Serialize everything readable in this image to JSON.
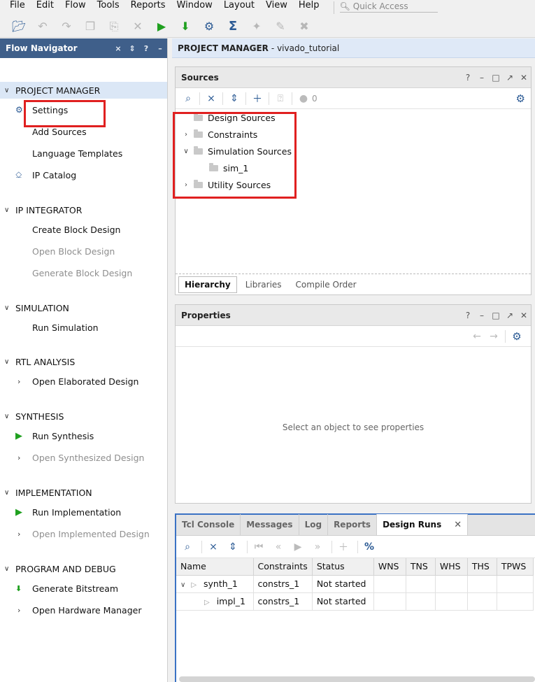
{
  "menubar": {
    "items": [
      "File",
      "Edit",
      "Flow",
      "Tools",
      "Reports",
      "Window",
      "Layout",
      "View",
      "Help"
    ],
    "quick_access_placeholder": "Quick Access"
  },
  "flow_navigator": {
    "title": "Flow Navigator",
    "sections": [
      {
        "label": "PROJECT MANAGER",
        "items": [
          "Settings",
          "Add Sources",
          "Language Templates",
          "IP Catalog"
        ]
      },
      {
        "label": "IP INTEGRATOR",
        "items": [
          "Create Block Design",
          "Open Block Design",
          "Generate Block Design"
        ]
      },
      {
        "label": "SIMULATION",
        "items": [
          "Run Simulation"
        ]
      },
      {
        "label": "RTL ANALYSIS",
        "items": [
          "Open Elaborated Design"
        ]
      },
      {
        "label": "SYNTHESIS",
        "items": [
          "Run Synthesis",
          "Open Synthesized Design"
        ]
      },
      {
        "label": "IMPLEMENTATION",
        "items": [
          "Run Implementation",
          "Open Implemented Design"
        ]
      },
      {
        "label": "PROGRAM AND DEBUG",
        "items": [
          "Generate Bitstream",
          "Open Hardware Manager"
        ]
      }
    ]
  },
  "project_manager": {
    "title_bold": "PROJECT MANAGER",
    "title_rest": "- vivado_tutorial"
  },
  "sources": {
    "title": "Sources",
    "count": "0",
    "tree": [
      "Design Sources",
      "Constraints",
      "Simulation Sources",
      "sim_1",
      "Utility Sources"
    ],
    "tabs": [
      "Hierarchy",
      "Libraries",
      "Compile Order"
    ]
  },
  "properties": {
    "title": "Properties",
    "empty_message": "Select an object to see properties"
  },
  "design_runs": {
    "tabs": [
      "Tcl Console",
      "Messages",
      "Log",
      "Reports",
      "Design Runs"
    ],
    "columns": [
      "Name",
      "Constraints",
      "Status",
      "WNS",
      "TNS",
      "WHS",
      "THS",
      "TPWS"
    ],
    "rows": [
      {
        "name": "synth_1",
        "constraints": "constrs_1",
        "status": "Not started"
      },
      {
        "name": "impl_1",
        "constraints": "constrs_1",
        "status": "Not started"
      }
    ]
  },
  "colors": {
    "nav_header": "#3f5f8a",
    "highlight": "#e02020",
    "selection": "#dbe7f6",
    "run_green": "#1fa01f"
  }
}
